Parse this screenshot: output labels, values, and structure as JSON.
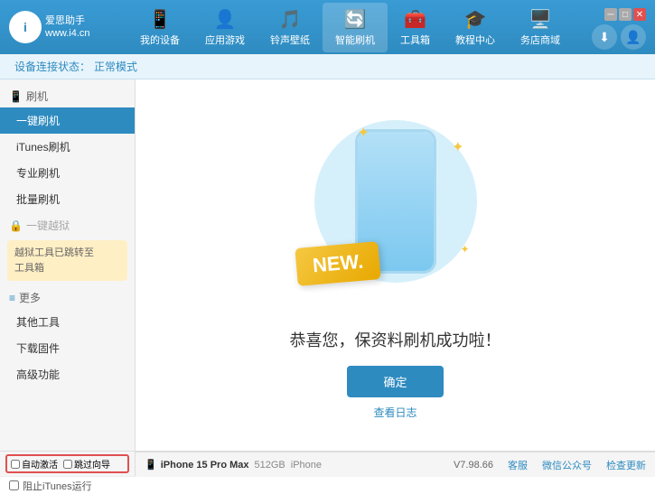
{
  "header": {
    "logo": {
      "circle_text": "i",
      "name": "爱思助手",
      "url": "www.i4.cn"
    },
    "nav": [
      {
        "id": "my-device",
        "icon": "📱",
        "label": "我的设备"
      },
      {
        "id": "app-games",
        "icon": "👤",
        "label": "应用游戏"
      },
      {
        "id": "ringtone",
        "icon": "🎵",
        "label": "铃声壁纸"
      },
      {
        "id": "smart-flash",
        "icon": "🔄",
        "label": "智能刷机",
        "active": true
      },
      {
        "id": "toolbox",
        "icon": "🧰",
        "label": "工具箱"
      },
      {
        "id": "tutorials",
        "icon": "🎓",
        "label": "教程中心"
      },
      {
        "id": "service",
        "icon": "🖥️",
        "label": "务店商域"
      }
    ],
    "win_controls": [
      "minimize",
      "maximize",
      "close"
    ],
    "right_icons": [
      "download",
      "user"
    ]
  },
  "topbar": {
    "prefix": "设备连接状态：",
    "status": "正常模式"
  },
  "sidebar": {
    "sections": [
      {
        "header": {
          "icon": "📱",
          "label": "刷机"
        },
        "items": [
          {
            "id": "one-click-flash",
            "label": "一键刷机",
            "active": true
          },
          {
            "id": "itunes-flash",
            "label": "iTunes刷机",
            "active": false
          },
          {
            "id": "pro-flash",
            "label": "专业刷机",
            "active": false
          },
          {
            "id": "batch-flash",
            "label": "批量刷机",
            "active": false
          }
        ]
      },
      {
        "header": {
          "icon": "🔒",
          "label": "一键越狱",
          "disabled": true
        },
        "notice": "越狱工具已跳转至\n工具箱"
      },
      {
        "header": {
          "icon": "≡",
          "label": "更多"
        },
        "items": [
          {
            "id": "other-tools",
            "label": "其他工具",
            "active": false
          },
          {
            "id": "download-firmware",
            "label": "下载固件",
            "active": false
          },
          {
            "id": "advanced",
            "label": "高级功能",
            "active": false
          }
        ]
      }
    ]
  },
  "content": {
    "success_title": "恭喜您，保资料刷机成功啦！",
    "confirm_btn": "确定",
    "log_link": "查看日志"
  },
  "bottom_left": {
    "checkbox1_label": "自动激活",
    "checkbox2_label": "跳过向导",
    "device_icon": "📱",
    "device_name": "iPhone 15 Pro Max",
    "device_storage": "512GB",
    "device_type": "iPhone"
  },
  "bottom_bar": {
    "itunes_checkbox": "阻止iTunes运行",
    "version": "V7.98.66",
    "links": [
      "客服",
      "微信公众号",
      "检查更新"
    ]
  }
}
